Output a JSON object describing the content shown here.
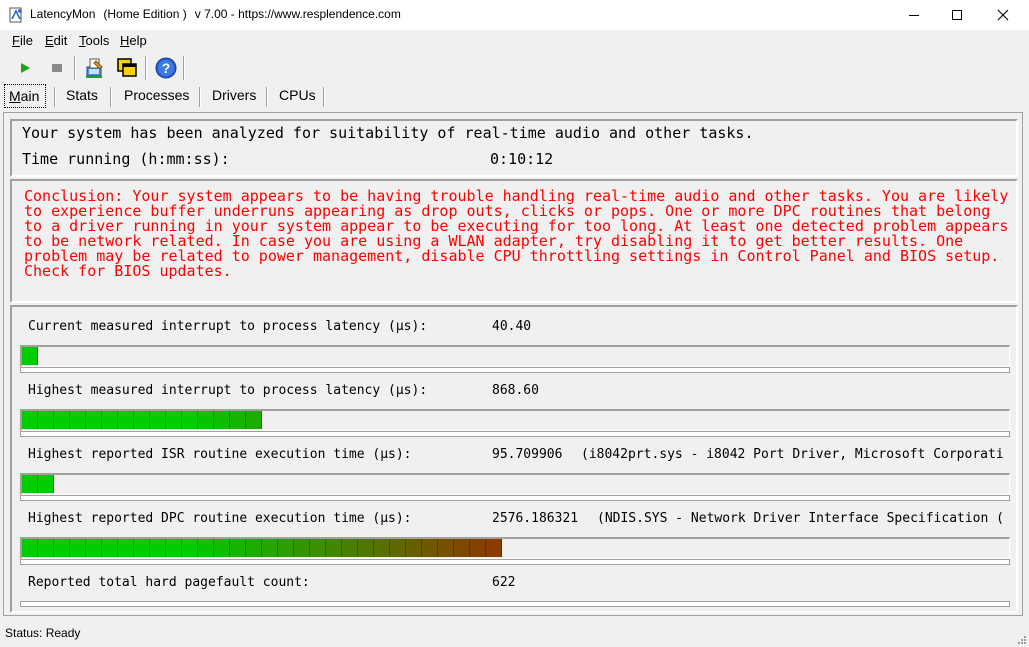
{
  "window": {
    "app_name": "LatencyMon",
    "edition": "(Home Edition )",
    "version": "v 7.00 - https://www.resplendence.com"
  },
  "menu": [
    {
      "key": "F",
      "rest": "ile"
    },
    {
      "key": "E",
      "rest": "dit"
    },
    {
      "key": "T",
      "rest": "ools"
    },
    {
      "key": "H",
      "rest": "elp"
    }
  ],
  "toolbar": {
    "icons": [
      "play-icon",
      "stop-icon",
      "report-icon",
      "windows-icon",
      "help-icon"
    ]
  },
  "tabs": [
    {
      "key": "M",
      "rest": "ain",
      "active": true
    },
    {
      "key": "S",
      "rest": "tats",
      "active": false
    },
    {
      "key": "P",
      "rest": "rocesses",
      "active": false
    },
    {
      "key": "D",
      "rest": "rivers",
      "active": false
    },
    {
      "key": "C",
      "rest": "PUs",
      "active": false
    }
  ],
  "summary": {
    "analyzed_text": "Your system has been analyzed for suitability of real-time audio and other tasks.",
    "time_label": "Time running (h:mm:ss):",
    "time_value": "0:10:12"
  },
  "conclusion": "Conclusion: Your system appears to be having trouble handling real-time audio and other tasks. You are likely to experience buffer underruns appearing as drop outs, clicks or pops. One or more DPC routines that belong to a driver running in your system appear to be executing for too long. At least one detected problem appears to be network related. In case you are using a WLAN adapter, try disabling it to get better results. One problem may be related to power management, disable CPU throttling settings in Control Panel and BIOS setup. Check for BIOS updates.",
  "metrics": [
    {
      "label": "Current measured interrupt to process latency (µs):",
      "value": "40.40",
      "extra": "",
      "segments": 1
    },
    {
      "label": "Highest measured interrupt to process latency (µs):",
      "value": "868.60",
      "extra": "",
      "segments": 15
    },
    {
      "label": "Highest reported ISR routine execution time (µs):",
      "value": "95.709906",
      "extra": "(i8042prt.sys - i8042 Port Driver, Microsoft Corporati",
      "segments": 2
    },
    {
      "label": "Highest reported DPC routine execution time (µs):",
      "value": "2576.186321",
      "extra": "(NDIS.SYS - Network Driver Interface Specification (",
      "segments": 30
    },
    {
      "label": "Reported total hard pagefault count:",
      "value": "622",
      "extra": "",
      "segments": 0
    }
  ],
  "status": "Status: Ready",
  "colors": {
    "conclusion": "#ff0000",
    "bar_green": "#00cc00",
    "bar_brown": "#8b3a00"
  }
}
